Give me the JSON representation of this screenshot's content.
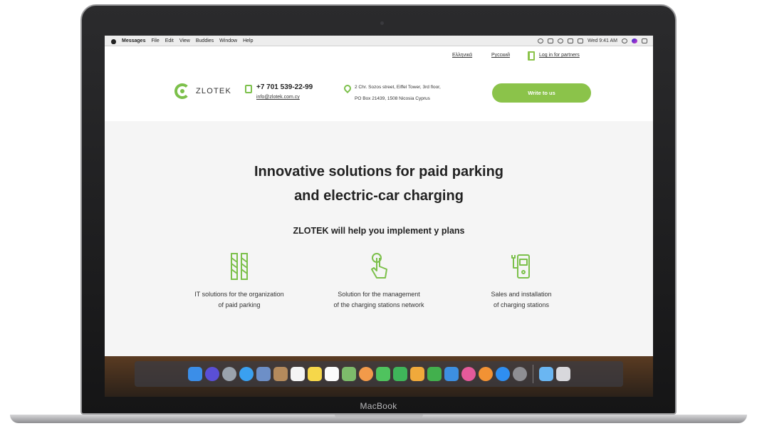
{
  "device": {
    "brand_label": "MacBook"
  },
  "menubar": {
    "app_name": "Messages",
    "menus": [
      "File",
      "Edit",
      "View",
      "Buddies",
      "Window",
      "Help"
    ],
    "clock": "Wed 9:41 AM"
  },
  "site": {
    "languages": [
      "Ελληνικά",
      "Русский"
    ],
    "partner_login": "Log in for partners",
    "logo_text": "ZLOTEK",
    "phone": "+7 701 539-22-99",
    "email": "info@zlotek.com.cy",
    "address_line1": "2 Chr. Sozos street, Eiffel Tower, 3rd floor,",
    "address_line2": "PO Box 21439, 1508 Nicosia Cyprus",
    "cta_button": "Write to us",
    "accent_color": "#8bc34a"
  },
  "hero": {
    "title_line1": "Innovative solutions for paid parking",
    "title_line2": "and electric-car charging",
    "subtitle": "ZLOTEK will help you implement y plans"
  },
  "features": [
    {
      "icon": "parking-barrier-icon",
      "line1": "IT solutions for the organization",
      "line2": "of paid parking"
    },
    {
      "icon": "touch-pointer-icon",
      "line1": "Solution for the management",
      "line2": "of the charging stations network"
    },
    {
      "icon": "charging-station-icon",
      "line1": "Sales and installation",
      "line2": "of charging stations"
    }
  ],
  "dock": {
    "apps": [
      {
        "name": "finder-icon",
        "color": "#3b8ee8"
      },
      {
        "name": "siri-icon",
        "color": "#5a4fd6"
      },
      {
        "name": "launchpad-icon",
        "color": "#9aa3ad"
      },
      {
        "name": "safari-icon",
        "color": "#3aa0f0"
      },
      {
        "name": "mail-icon",
        "color": "#6d8fc7"
      },
      {
        "name": "contacts-icon",
        "color": "#b48a5c"
      },
      {
        "name": "calendar-icon",
        "color": "#f4f4f4"
      },
      {
        "name": "notes-icon",
        "color": "#f6d74a"
      },
      {
        "name": "reminders-icon",
        "color": "#fbfbfb"
      },
      {
        "name": "maps-icon",
        "color": "#7dbb6b"
      },
      {
        "name": "photos-icon",
        "color": "#f29a4a"
      },
      {
        "name": "messages-icon",
        "color": "#4fc35e"
      },
      {
        "name": "facetime-icon",
        "color": "#3fb55a"
      },
      {
        "name": "pages-icon",
        "color": "#f0a93b"
      },
      {
        "name": "numbers-icon",
        "color": "#42b04d"
      },
      {
        "name": "keynote-icon",
        "color": "#3d8fe0"
      },
      {
        "name": "itunes-icon",
        "color": "#e45a9a"
      },
      {
        "name": "ibooks-icon",
        "color": "#f29234"
      },
      {
        "name": "app-store-icon",
        "color": "#2f8ef0"
      },
      {
        "name": "system-preferences-icon",
        "color": "#8e8e93"
      }
    ],
    "trailing": [
      {
        "name": "downloads-folder-icon",
        "color": "#6ab6f2"
      },
      {
        "name": "trash-icon",
        "color": "#d8d8dc"
      }
    ]
  }
}
